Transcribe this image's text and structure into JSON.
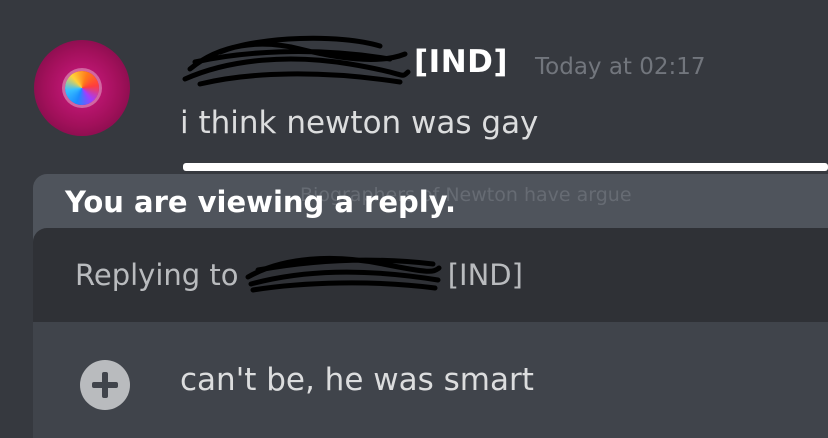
{
  "message": {
    "author_tag": "[IND]",
    "timestamp": "Today at 02:17",
    "content": "i think newton was gay"
  },
  "reply_overlay": {
    "title": "You are viewing a reply.",
    "ghost_line_1": "Biographers of Newton have argue"
  },
  "reply_bar": {
    "prefix": "Replying to",
    "author_tag": "[IND]"
  },
  "composer": {
    "value": "can't be, he was smart",
    "add_icon": "plus-circle-icon"
  },
  "colors": {
    "background": "#36393f",
    "reply_panel": "#4f545c",
    "reply_bar": "#2f3136",
    "input_bar": "#40444b",
    "timestamp": "#72767d",
    "avatar": "#d01a83"
  }
}
